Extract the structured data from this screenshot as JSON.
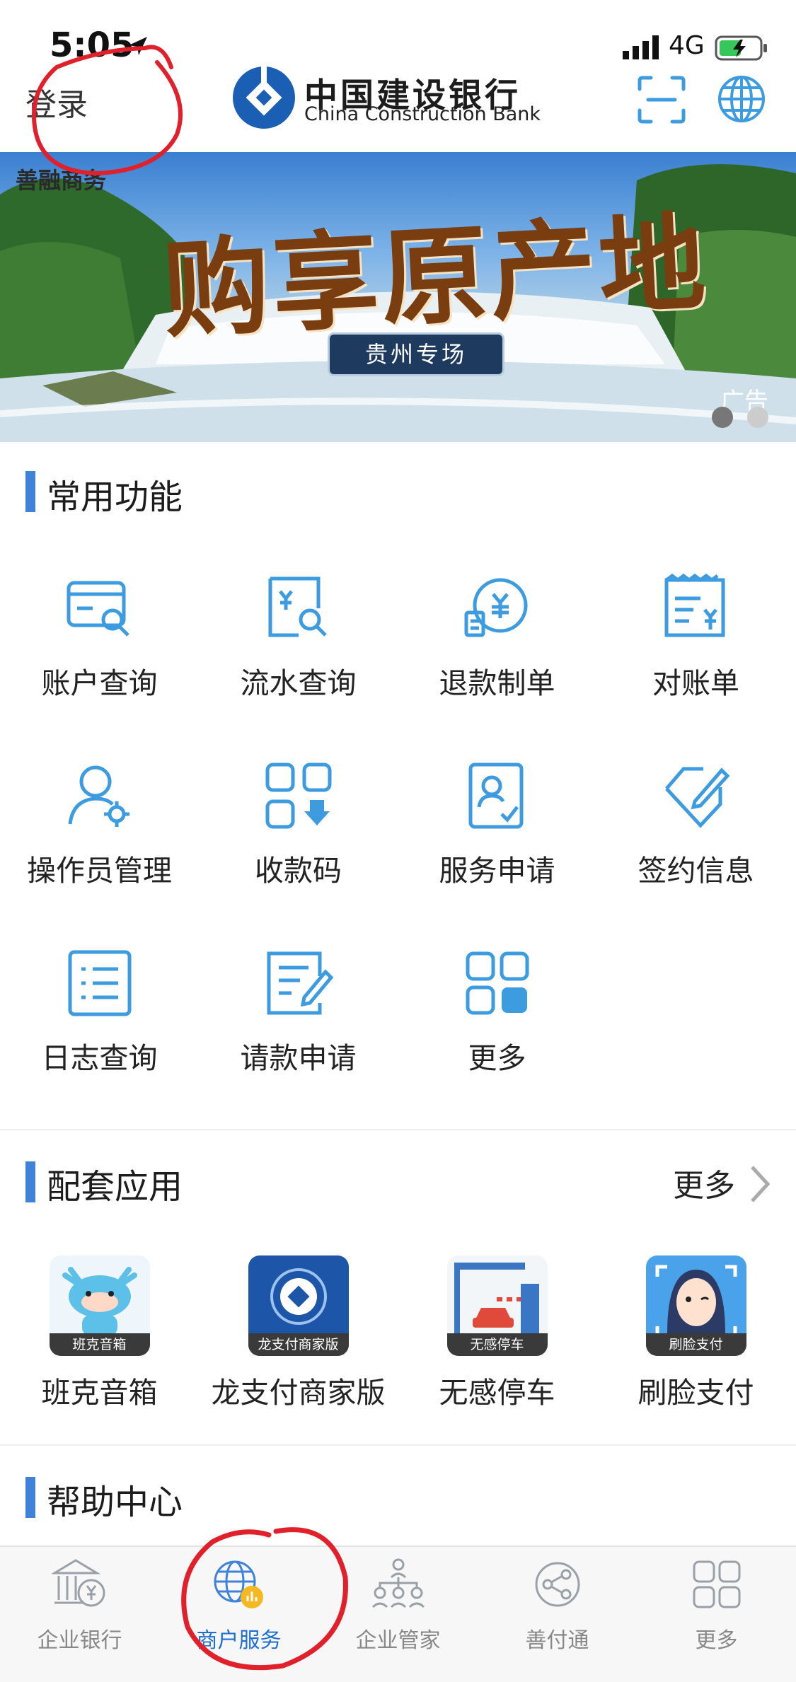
{
  "status_bar": {
    "time": "5:05",
    "network": "4G"
  },
  "header": {
    "login_label": "登录",
    "brand_cn": "中国建设银行",
    "brand_en": "China Construction Bank",
    "scan_icon": "scan-icon",
    "language_icon": "globe-icon"
  },
  "banner": {
    "tag": "善融商务",
    "title": "购享原产地",
    "subtitle": "贵州专场",
    "ad_label": "广告",
    "page_count": 2,
    "active_page": 1
  },
  "common_functions": {
    "title": "常用功能",
    "items": [
      {
        "label": "账户查询",
        "icon": "account-query-icon"
      },
      {
        "label": "流水查询",
        "icon": "transaction-query-icon"
      },
      {
        "label": "退款制单",
        "icon": "refund-icon"
      },
      {
        "label": "对账单",
        "icon": "statement-icon"
      },
      {
        "label": "操作员管理",
        "icon": "operator-manage-icon"
      },
      {
        "label": "收款码",
        "icon": "payment-code-icon"
      },
      {
        "label": "服务申请",
        "icon": "service-apply-icon"
      },
      {
        "label": "签约信息",
        "icon": "contract-info-icon"
      },
      {
        "label": "日志查询",
        "icon": "log-query-icon"
      },
      {
        "label": "请款申请",
        "icon": "payment-request-icon"
      },
      {
        "label": "更多",
        "icon": "more-grid-icon"
      }
    ]
  },
  "apps": {
    "title": "配套应用",
    "more_label": "更多",
    "items": [
      {
        "label": "班克音箱",
        "caption": "班克音箱"
      },
      {
        "label": "龙支付商家版",
        "caption": "龙支付商家版"
      },
      {
        "label": "无感停车",
        "caption": "无感停车"
      },
      {
        "label": "刷脸支付",
        "caption": "刷脸支付"
      }
    ]
  },
  "help": {
    "title": "帮助中心"
  },
  "tabbar": {
    "items": [
      {
        "label": "企业银行",
        "active": false
      },
      {
        "label": "商户服务",
        "active": true
      },
      {
        "label": "企业管家",
        "active": false
      },
      {
        "label": "善付通",
        "active": false
      },
      {
        "label": "更多",
        "active": false
      }
    ]
  },
  "colors": {
    "accent": "#3f82d8",
    "icon_blue": "#3d9be0",
    "tab_active": "#1f6fd1",
    "annotation": "#e0202a"
  }
}
